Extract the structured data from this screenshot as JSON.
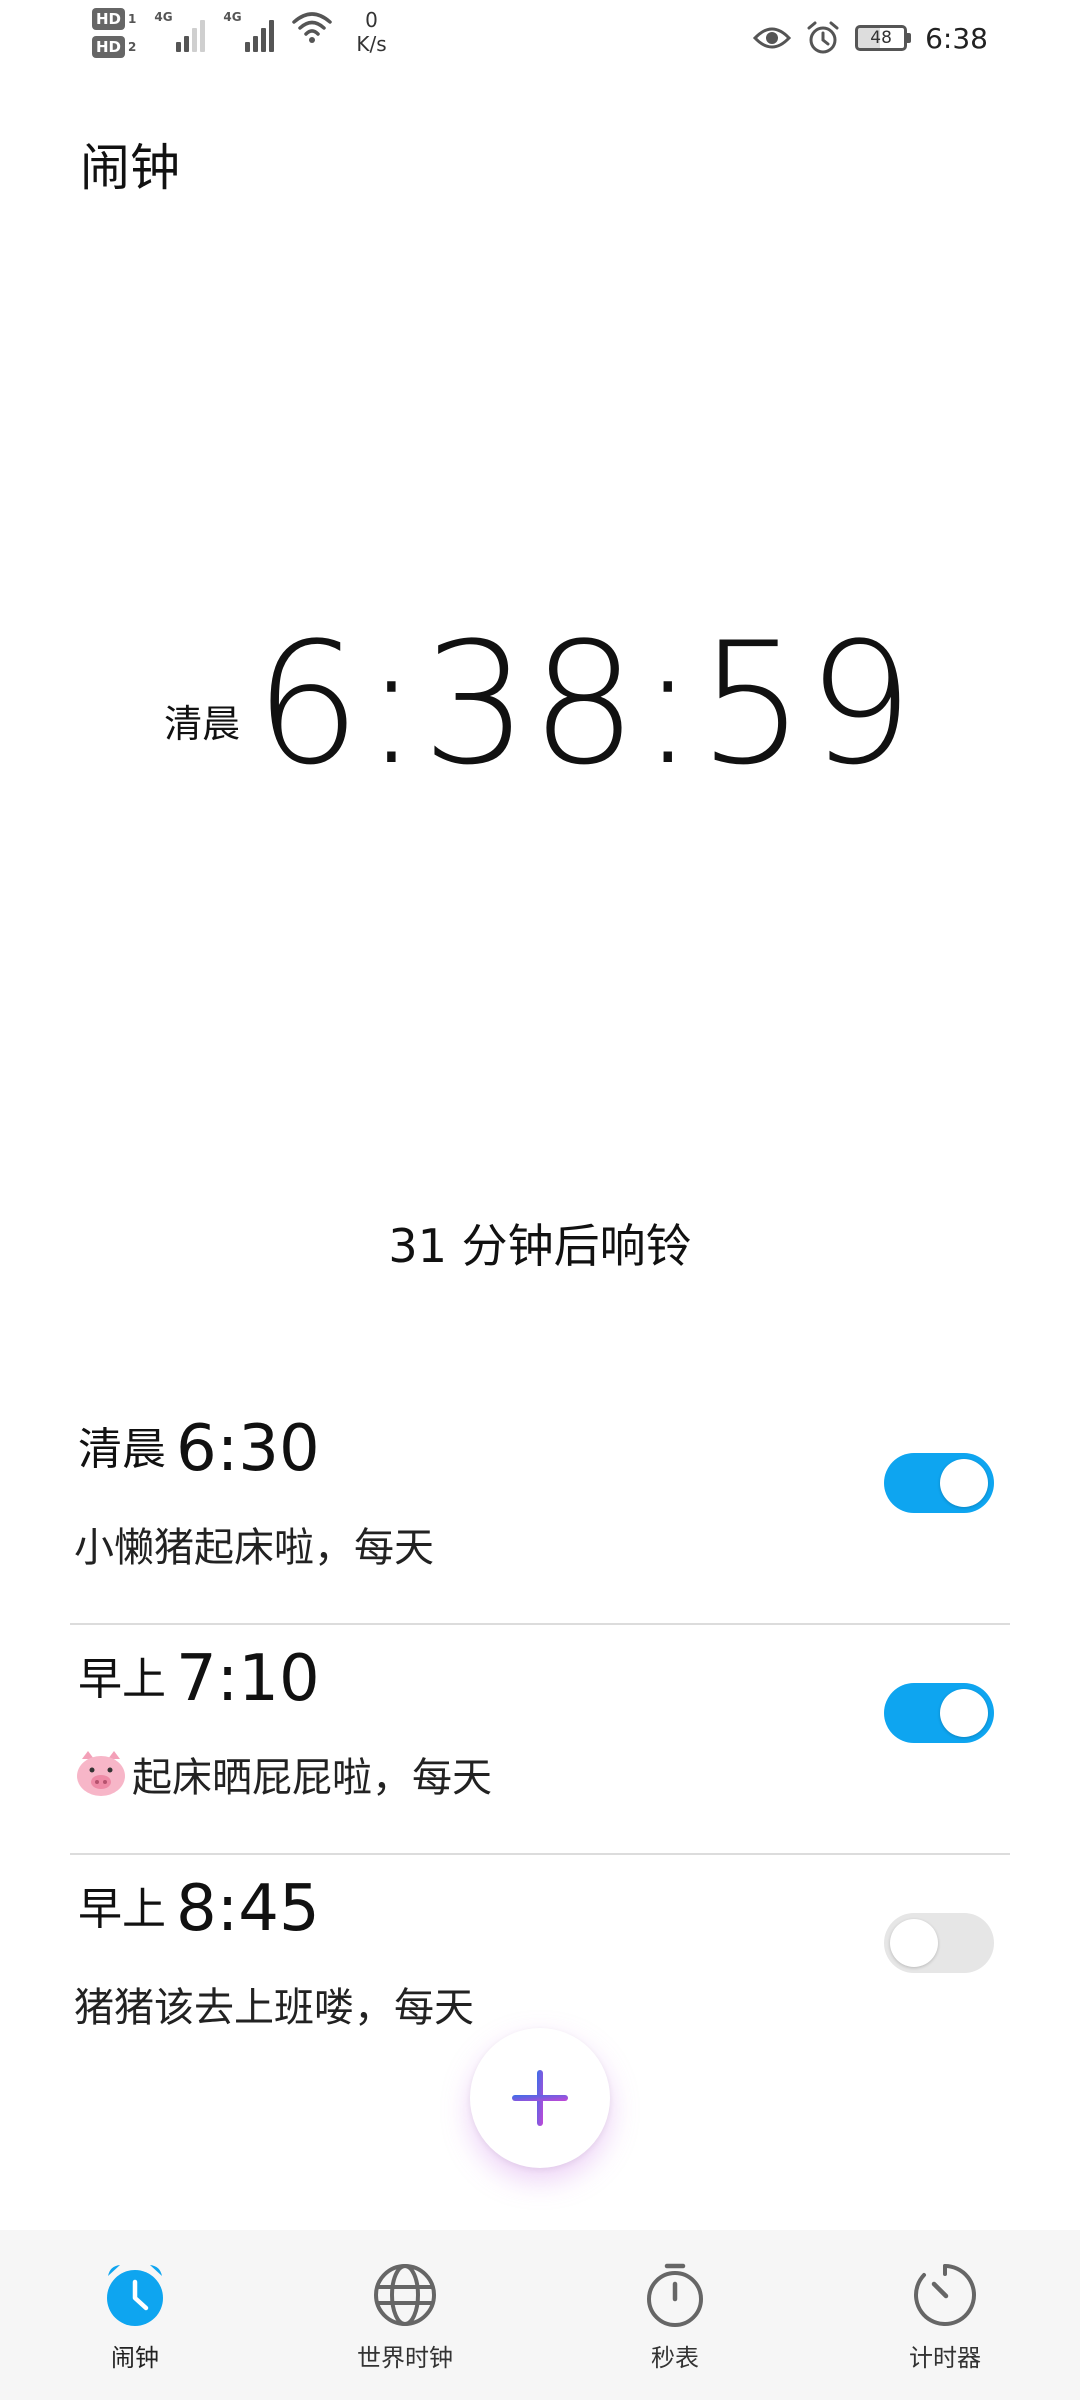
{
  "status_bar": {
    "sim1_badge": "HD",
    "sim1_num": "1",
    "sim2_badge": "HD",
    "sim2_num": "2",
    "net1": "4G",
    "net2": "4G",
    "speed_value": "0",
    "speed_unit": "K/s",
    "battery": "48",
    "time": "6:38",
    "icons": [
      "eye-icon",
      "alarm-icon",
      "wifi-icon",
      "signal-icon"
    ]
  },
  "header": {
    "title": "闹钟"
  },
  "current": {
    "period": "清晨",
    "time": "6:38:59"
  },
  "next_ring": "31 分钟后响铃",
  "alarms": [
    {
      "period": "清晨",
      "time": "6:30",
      "label": "小懒猪起床啦，每天",
      "enabled": true
    },
    {
      "period": "早上",
      "time": "7:10",
      "label": "起床晒屁屁啦，每天",
      "enabled": true,
      "emoji": "pig-face"
    },
    {
      "period": "早上",
      "time": "8:45",
      "label": "猪猪该去上班喽，每天",
      "enabled": false
    }
  ],
  "fab": {
    "icon": "plus-icon"
  },
  "nav": [
    {
      "label": "闹钟",
      "icon": "alarm-clock-icon",
      "active": true
    },
    {
      "label": "世界时钟",
      "icon": "globe-icon",
      "active": false
    },
    {
      "label": "秒表",
      "icon": "stopwatch-icon",
      "active": false
    },
    {
      "label": "计时器",
      "icon": "timer-icon",
      "active": false
    }
  ],
  "colors": {
    "accent": "#0ea5f0",
    "toggle_off": "#e6e6e6",
    "fab_plus_start": "#3a6fe8",
    "fab_plus_end": "#c447d6"
  }
}
